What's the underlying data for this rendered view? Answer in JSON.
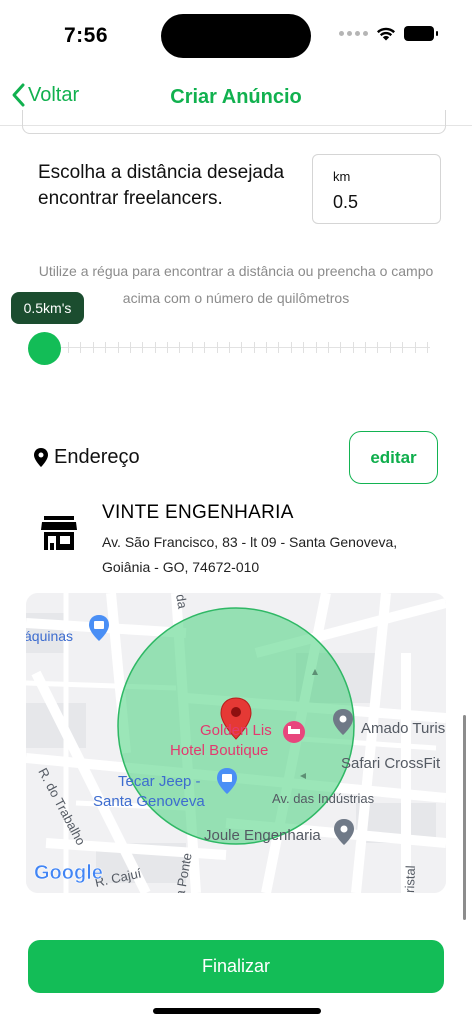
{
  "status": {
    "time": "7:56"
  },
  "nav": {
    "back_label": "Voltar",
    "title": "Criar Anúncio"
  },
  "distance": {
    "label": "Escolha a distância desejada encontrar freelancers.",
    "unit_label": "km",
    "value": "0.5",
    "helper": "Utilize a régua para encontrar a distância ou preencha o campo acima com o número de quilômetros",
    "tooltip": "0.5km's",
    "slider_level": 0
  },
  "address": {
    "title": "Endereço",
    "edit_label": "editar",
    "company_name": "VINTE ENGENHARIA",
    "company_address": "Av. São Francisco, 83 - lt 09 - Santa Genoveva, Goiânia - GO, 74672-010"
  },
  "map": {
    "labels": {
      "aquinas": "áquinas",
      "amado": "Amado Turis",
      "safari": "Safari CrossFit",
      "golden1": "Golden Lis",
      "golden2": "Hotel Boutique",
      "tecar1": "Tecar Jeep -",
      "tecar2": "Santa Genoveva",
      "industrias": "Av. das Indústrias",
      "joule": "Joule Engenharia",
      "trabalho": "R. do Trabalho",
      "cajui": "R. Cajuí",
      "ponte": "a Ponte",
      "ristal": "ristal",
      "da": "da",
      "google": "Google"
    },
    "colors": {
      "radius_fill": "#49d17e",
      "pin": "#e53935",
      "poi_blue": "#4a8ff5",
      "poi_pink": "#e8467d"
    }
  },
  "footer": {
    "finalize_label": "Finalizar"
  },
  "colors": {
    "accent": "#13bd57",
    "tooltip_bg": "#1b4d2f"
  }
}
